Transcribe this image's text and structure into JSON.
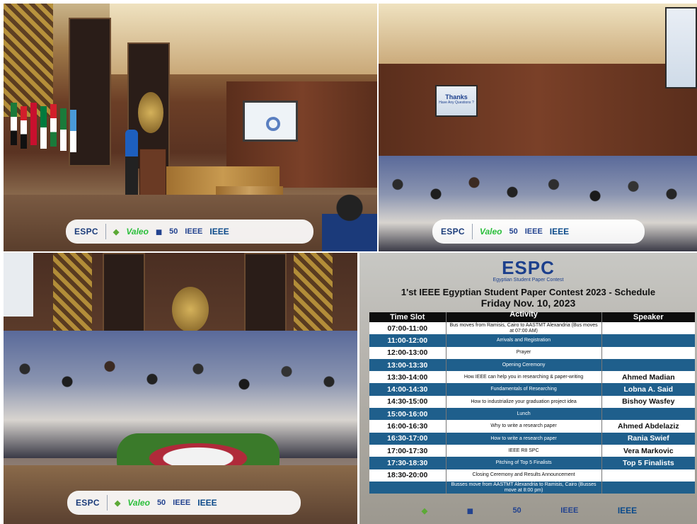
{
  "sponsors": {
    "espc": "ESPC",
    "valeo": "Valeo",
    "ieee": "IEEE",
    "ieee_r8": "IEEE",
    "fifty": "50"
  },
  "schedule": {
    "logo_text": "ESPC",
    "logo_subtext": "Egyptian Student Paper Contest",
    "title": "1'st IEEE Egyptian Student Paper Contest 2023 - Schedule",
    "date": "Friday Nov. 10, 2023",
    "headers": {
      "time": "Time Slot",
      "activity": "Activity",
      "speaker": "Speaker"
    },
    "rows": [
      {
        "time": "07:00-11:00",
        "activity": "Bus moves from Ramisis, Cairo to AASTMT Alexandria (Bus moves at 07:00 AM)",
        "speaker": ""
      },
      {
        "time": "11:00-12:00",
        "activity": "Arrivals and Registration",
        "speaker": ""
      },
      {
        "time": "12:00-13:00",
        "activity": "Prayer",
        "speaker": ""
      },
      {
        "time": "13:00-13:30",
        "activity": "Opening Ceremony",
        "speaker": ""
      },
      {
        "time": "13:30-14:00",
        "activity": "How IEEE can help you in researching & paper-writing",
        "speaker": "Ahmed Madian"
      },
      {
        "time": "14:00-14:30",
        "activity": "Fundamentals of Researching",
        "speaker": "Lobna A. Said"
      },
      {
        "time": "14:30-15:00",
        "activity": "How to industrialize your graduation project idea",
        "speaker": "Bishoy Wasfey"
      },
      {
        "time": "15:00-16:00",
        "activity": "Lunch",
        "speaker": ""
      },
      {
        "time": "16:00-16:30",
        "activity": "Why to write a research paper",
        "speaker": "Ahmed Abdelaziz"
      },
      {
        "time": "16:30-17:00",
        "activity": "How to write a research paper",
        "speaker": "Rania Swief"
      },
      {
        "time": "17:00-17:30",
        "activity": "IEEE R8 SPC",
        "speaker": "Vera Markovic"
      },
      {
        "time": "17:30-18:30",
        "activity": "Pitching of Top 5 Finalists",
        "speaker": "Top 5 Finalists"
      },
      {
        "time": "18:30-20:00",
        "activity": "Closing Ceremony and Results Announcement",
        "speaker": ""
      },
      {
        "time": "",
        "activity": "Busses move from AASTMT Alexandria to Ramisis, Cairo (Busses move at 8:00 pm)",
        "speaker": ""
      }
    ]
  },
  "screen_text": {
    "thanks": "Thanks",
    "questions": "Have Any Questions ?"
  },
  "colors": {
    "row_dark": "#1f5f8c",
    "row_light": "#ffffff",
    "header_bg": "#0d0d0d",
    "espc_blue": "#1c3f8c"
  }
}
